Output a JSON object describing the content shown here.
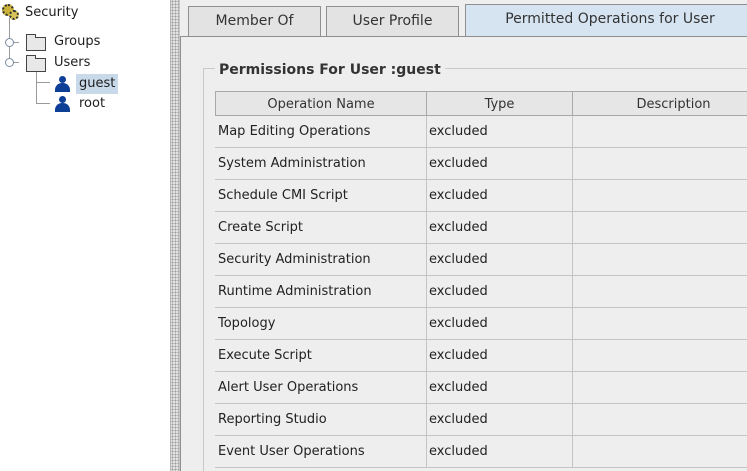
{
  "tree": {
    "root": {
      "label": "Security",
      "icon": "gear-icon"
    },
    "groups": {
      "label": "Groups",
      "icon": "folder-icon"
    },
    "users": {
      "label": "Users",
      "icon": "folder-icon",
      "children": [
        {
          "label": "guest",
          "icon": "user-icon",
          "selected": true
        },
        {
          "label": "root",
          "icon": "user-icon",
          "selected": false
        }
      ]
    }
  },
  "tabs": [
    {
      "label": "Member Of",
      "active": false
    },
    {
      "label": "User Profile",
      "active": false
    },
    {
      "label": "Permitted Operations for User",
      "active": true
    }
  ],
  "permissions": {
    "title": "Permissions For User :guest",
    "columns": [
      "Operation Name",
      "Type",
      "Description"
    ],
    "rows": [
      {
        "operation": "Map Editing Operations",
        "type": "excluded",
        "description": ""
      },
      {
        "operation": "System Administration",
        "type": "excluded",
        "description": ""
      },
      {
        "operation": "Schedule CMI Script",
        "type": "excluded",
        "description": ""
      },
      {
        "operation": "Create Script",
        "type": "excluded",
        "description": ""
      },
      {
        "operation": "Security Administration",
        "type": "excluded",
        "description": ""
      },
      {
        "operation": "Runtime Administration",
        "type": "excluded",
        "description": ""
      },
      {
        "operation": "Topology",
        "type": "excluded",
        "description": ""
      },
      {
        "operation": "Execute Script",
        "type": "excluded",
        "description": ""
      },
      {
        "operation": "Alert User Operations",
        "type": "excluded",
        "description": ""
      },
      {
        "operation": "Reporting Studio",
        "type": "excluded",
        "description": ""
      },
      {
        "operation": "Event User Operations",
        "type": "excluded",
        "description": ""
      }
    ]
  },
  "colors": {
    "selection": "#c8d9ea",
    "active_tab": "#d6e4f1",
    "user_icon": "#0d3f96",
    "panel_bg": "#eeeeee"
  }
}
